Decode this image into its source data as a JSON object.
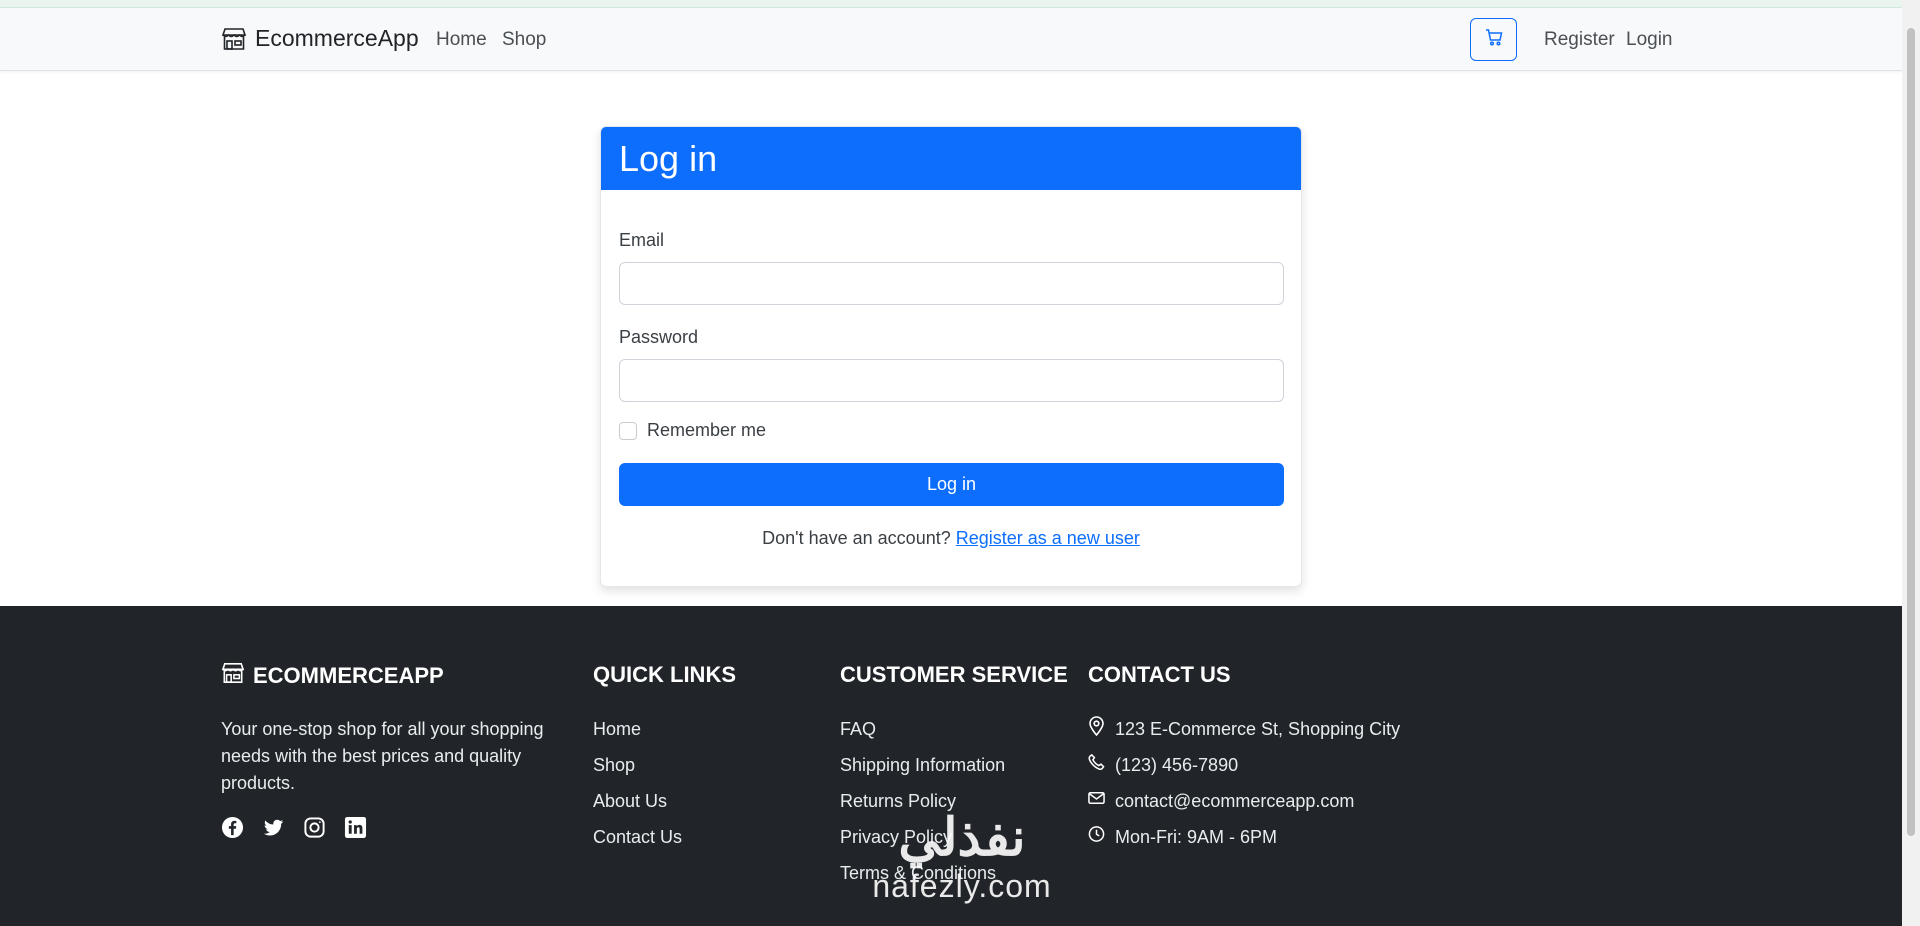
{
  "navbar": {
    "brand": "EcommerceApp",
    "links": [
      "Home",
      "Shop"
    ],
    "right_links": [
      "Register",
      "Login"
    ]
  },
  "login_card": {
    "title": "Log in",
    "email_label": "Email",
    "email_value": "",
    "password_label": "Password",
    "password_value": "",
    "remember_label": "Remember me",
    "remember_checked": false,
    "submit_label": "Log in",
    "no_account_text": "Don't have an account?",
    "register_link": "Register as a new user"
  },
  "footer": {
    "brand_heading": "ECOMMERCEAPP",
    "tagline": "Your one-stop shop for all your shopping needs with the best prices and quality products.",
    "socials": [
      "facebook-icon",
      "twitter-icon",
      "instagram-icon",
      "linkedin-icon"
    ],
    "quick_links_heading": "QUICK LINKS",
    "quick_links": [
      "Home",
      "Shop",
      "About Us",
      "Contact Us"
    ],
    "customer_service_heading": "CUSTOMER SERVICE",
    "customer_service": [
      "FAQ",
      "Shipping Information",
      "Returns Policy",
      "Privacy Policy",
      "Terms & Conditions"
    ],
    "contact_heading": "CONTACT US",
    "contact": [
      {
        "icon": "map-pin-icon",
        "text": "123 E-Commerce St, Shopping City"
      },
      {
        "icon": "phone-icon",
        "text": "(123) 456-7890"
      },
      {
        "icon": "envelope-icon",
        "text": "contact@ecommerceapp.com"
      },
      {
        "icon": "clock-icon",
        "text": "Mon-Fri: 9AM - 6PM"
      }
    ]
  },
  "watermark": {
    "arabic": "نفذلي",
    "latin": "nafezly.com"
  },
  "colors": {
    "primary": "#0d6efd",
    "footer_bg": "#212529",
    "navbar_bg": "#f8f9fa"
  }
}
